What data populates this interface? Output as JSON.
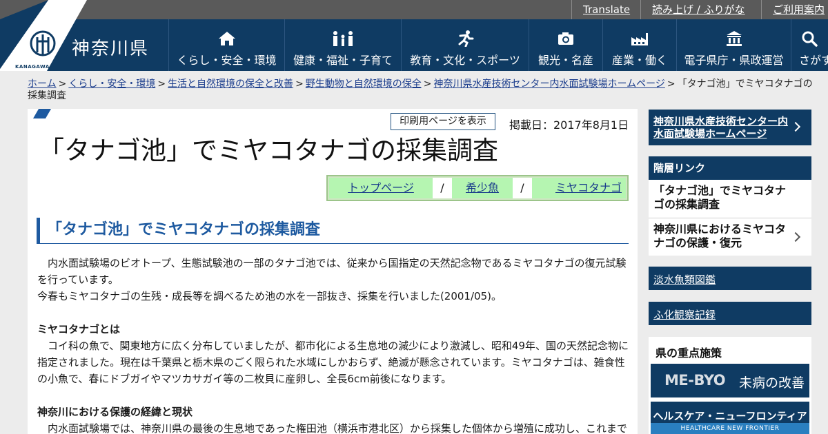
{
  "utility": {
    "translate": "Translate",
    "read_aloud": "読み上げ / ふりがな",
    "guide": "ご利用案内"
  },
  "header": {
    "site_name": "神奈川県",
    "logo_caption": "KANAGAWA",
    "nav": [
      {
        "label": "くらし・安全・環境",
        "icon": "house-icon"
      },
      {
        "label": "健康・福祉・子育て",
        "icon": "family-icon"
      },
      {
        "label": "教育・文化・スポーツ",
        "icon": "runner-icon"
      },
      {
        "label": "観光・名産",
        "icon": "camera-icon"
      },
      {
        "label": "産業・働く",
        "icon": "factory-icon"
      },
      {
        "label": "電子県庁・県政運営",
        "icon": "government-building-icon"
      },
      {
        "label": "さがす",
        "icon": "search-icon"
      }
    ]
  },
  "breadcrumb": {
    "items": [
      "ホーム",
      "くらし・安全・環境",
      "生活と自然環境の保全と改善",
      "野生動物と自然環境の保全",
      "神奈川県水産技術センター内水面試験場ホームページ"
    ],
    "separator": ">",
    "current": "「タナゴ池」でミヤコタナゴの採集調査"
  },
  "article": {
    "print_button": "印刷用ページを表示",
    "published": "掲載日：2017年8月1日",
    "title": "「タナゴ池」でミヤコタナゴの採集調査",
    "tags": [
      "トップページ",
      "希少魚",
      "ミヤコタナゴ"
    ],
    "tag_divider": "/",
    "heading": "「タナゴ池」でミヤコタナゴの採集調査",
    "paragraphs": {
      "p1": "　内水面試験場のビオトープ、生態試験池の一部のタナゴ池では、従来から国指定の天然記念物であるミヤコタナゴの復元試験を行っています。",
      "p2": "今春もミヤコタナゴの生残・成長等を調べるため池の水を一部抜き、採集を行いました(2001/05)。",
      "sub1": "ミヤコタナゴとは",
      "p3": "　コイ科の魚で、関東地方に広く分布していましたが、都市化による生息地の減少により激減し、昭和49年、国の天然記念物に指定されました。現在は千葉県と栃木県のごく限られた水域にしかおらず、絶滅が懸念されています。ミヤコタナゴは、雑食性の小魚で、春にドブガイやマツカサガイ等の二枚貝に産卵し、全長6cm前後になります。",
      "sub2": "神奈川における保護の経緯と現状",
      "p4": "　内水面試験場では、神奈川県の最後の生息地であった権田池（横浜市港北区）から採集した個体から増殖に成功し、これまで"
    }
  },
  "sidebar": {
    "home_link": "神奈川県水産技術センター内水面試験場ホームページ",
    "hierarchy_title": "階層リンク",
    "hierarchy_items": [
      "「タナゴ池」でミヤコタナゴの採集調査",
      "神奈川県におけるミヤコタナゴの保護・復元"
    ],
    "link1": "淡水魚類図鑑",
    "link2": "ふ化観察記録",
    "policy_title": "県の重点施策",
    "banner1_en": "ME-BYO",
    "banner1_jp": "未病の改善",
    "banner2_jp": "ヘルスケア・ニューフロンティア",
    "banner2_en": "HEALTHCARE NEW FRONTIER"
  },
  "colors": {
    "header_bg": "#0f3b63",
    "accent_blue": "#1e5aa0",
    "tag_green": "#b5f5b1",
    "util_bg": "#5a5a5a"
  }
}
